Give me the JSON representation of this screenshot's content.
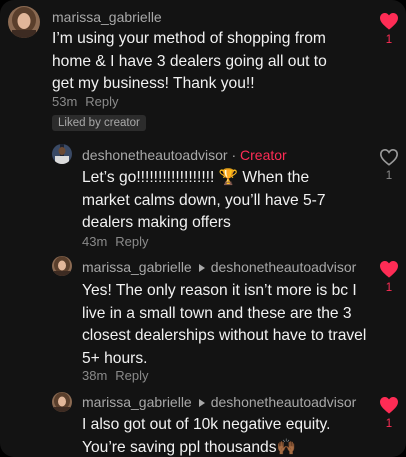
{
  "colors": {
    "background": "#131313",
    "accent": "#fe2c55",
    "text": "#f2f2f2",
    "muted": "#8a8a8a"
  },
  "comments": [
    {
      "username": "marissa_gabrielle",
      "text": "I’m using your method of shopping from home & I have 3 dealers going all out to get my business! Thank you!!",
      "time": "53m",
      "reply_label": "Reply",
      "badge": "Liked by creator",
      "likes": "1",
      "liked": true,
      "icon": "heart-filled-icon"
    },
    {
      "username": "deshonetheautoadvisor",
      "separator": "·",
      "creator_label": "Creator",
      "text": "Let’s go!!!!!!!!!!!!!!!!!! 🏆 When the market calms down, you’ll have 5-7 dealers making offers",
      "time": "43m",
      "reply_label": "Reply",
      "likes": "1",
      "liked": false,
      "icon": "heart-outline-icon"
    },
    {
      "username": "marissa_gabrielle",
      "reply_to": "deshonetheautoadvisor",
      "text": "Yes! The only reason it isn’t more is bc I live in a small town and these are the 3 closest dealerships without have to travel 5+ hours.",
      "time": "38m",
      "reply_label": "Reply",
      "likes": "1",
      "liked": true,
      "icon": "heart-filled-icon"
    },
    {
      "username": "marissa_gabrielle",
      "reply_to": "deshonetheautoadvisor",
      "text": "I also got out of 10k negative equity. You’re saving ppl thousands🙌🏾",
      "likes": "1",
      "liked": true,
      "icon": "heart-filled-icon"
    }
  ]
}
